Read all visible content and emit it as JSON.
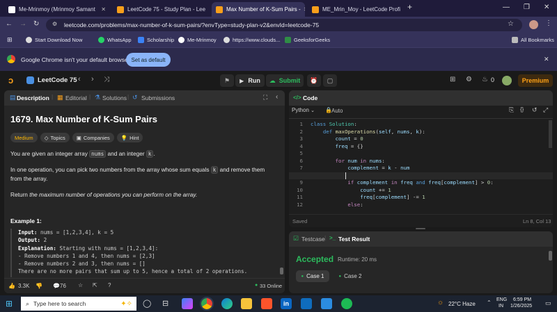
{
  "browser": {
    "tabs": [
      {
        "title": "Me-Mrinmoy (Mrinmoy Samant",
        "active": false
      },
      {
        "title": "LeetCode 75 - Study Plan - Lee",
        "active": false
      },
      {
        "title": "Max Number of K-Sum Pairs -",
        "active": true
      },
      {
        "title": "ME_Mrin_Moy - LeetCode Profi",
        "active": false
      }
    ],
    "new_tab": "+",
    "url": "leetcode.com/problems/max-number-of-k-sum-pairs/?envType=study-plan-v2&envId=leetcode-75",
    "bookmarks": [
      "Start Download Now",
      "WhatsApp",
      "Scholarship",
      "Me-Mrinmoy",
      "https://www.clouds...",
      "GeeksforGeeks"
    ],
    "all_bookmarks": "All Bookmarks",
    "infobar": {
      "message": "Google Chrome isn't your default browser",
      "button": "Set as default"
    }
  },
  "header": {
    "title": "LeetCode 75",
    "run": "Run",
    "submit": "Submit",
    "fire_count": "0",
    "premium": "Premium"
  },
  "left": {
    "tabs": [
      "Description",
      "Editorial",
      "Solutions",
      "Submissions"
    ],
    "problem_title": "1679. Max Number of K-Sum Pairs",
    "difficulty": "Medium",
    "tags": [
      "Topics",
      "Companies",
      "Hint"
    ],
    "para1_a": "You are given an integer array",
    "para1_code1": "nums",
    "para1_b": "and an integer",
    "para1_code2": "k",
    "para1_c": ".",
    "para2_a": "In one operation, you can pick two numbers from the array whose sum equals",
    "para2_code": "k",
    "para2_b": "and remove them",
    "para2_c": "from the array.",
    "para3_a": "Return",
    "para3_b": "the maximum number of operations you can perform on the array.",
    "example_title": "Example 1:",
    "example": {
      "input_label": "Input:",
      "input": "nums = [1,2,3,4], k = 5",
      "output_label": "Output:",
      "output": "2",
      "expl_label": "Explanation:",
      "expl": "Starting with nums = [1,2,3,4]:",
      "line1": "- Remove numbers 1 and 4, then nums = [2,3]",
      "line2": "- Remove numbers 2 and 3, then nums = []",
      "line3": "There are no more pairs that sum up to 5, hence a total of 2 operations."
    },
    "footer": {
      "likes": "3.3K",
      "comments": "76",
      "online": "33 Online"
    }
  },
  "code": {
    "panel_title": "Code",
    "language": "Python",
    "auto": "Auto",
    "status": "Saved",
    "cursor": "Ln 8, Col 13"
  },
  "result": {
    "tab_testcase": "Testcase",
    "tab_result": "Test Result",
    "verdict": "Accepted",
    "runtime": "Runtime: 20 ms",
    "cases": [
      "Case 1",
      "Case 2"
    ],
    "accent": "#2cbb5d"
  },
  "taskbar": {
    "search": "Type here to search",
    "weather": "22°C Haze",
    "lang1": "ENG",
    "lang2": "IN",
    "time": "6:59 PM",
    "date": "1/26/2025"
  }
}
